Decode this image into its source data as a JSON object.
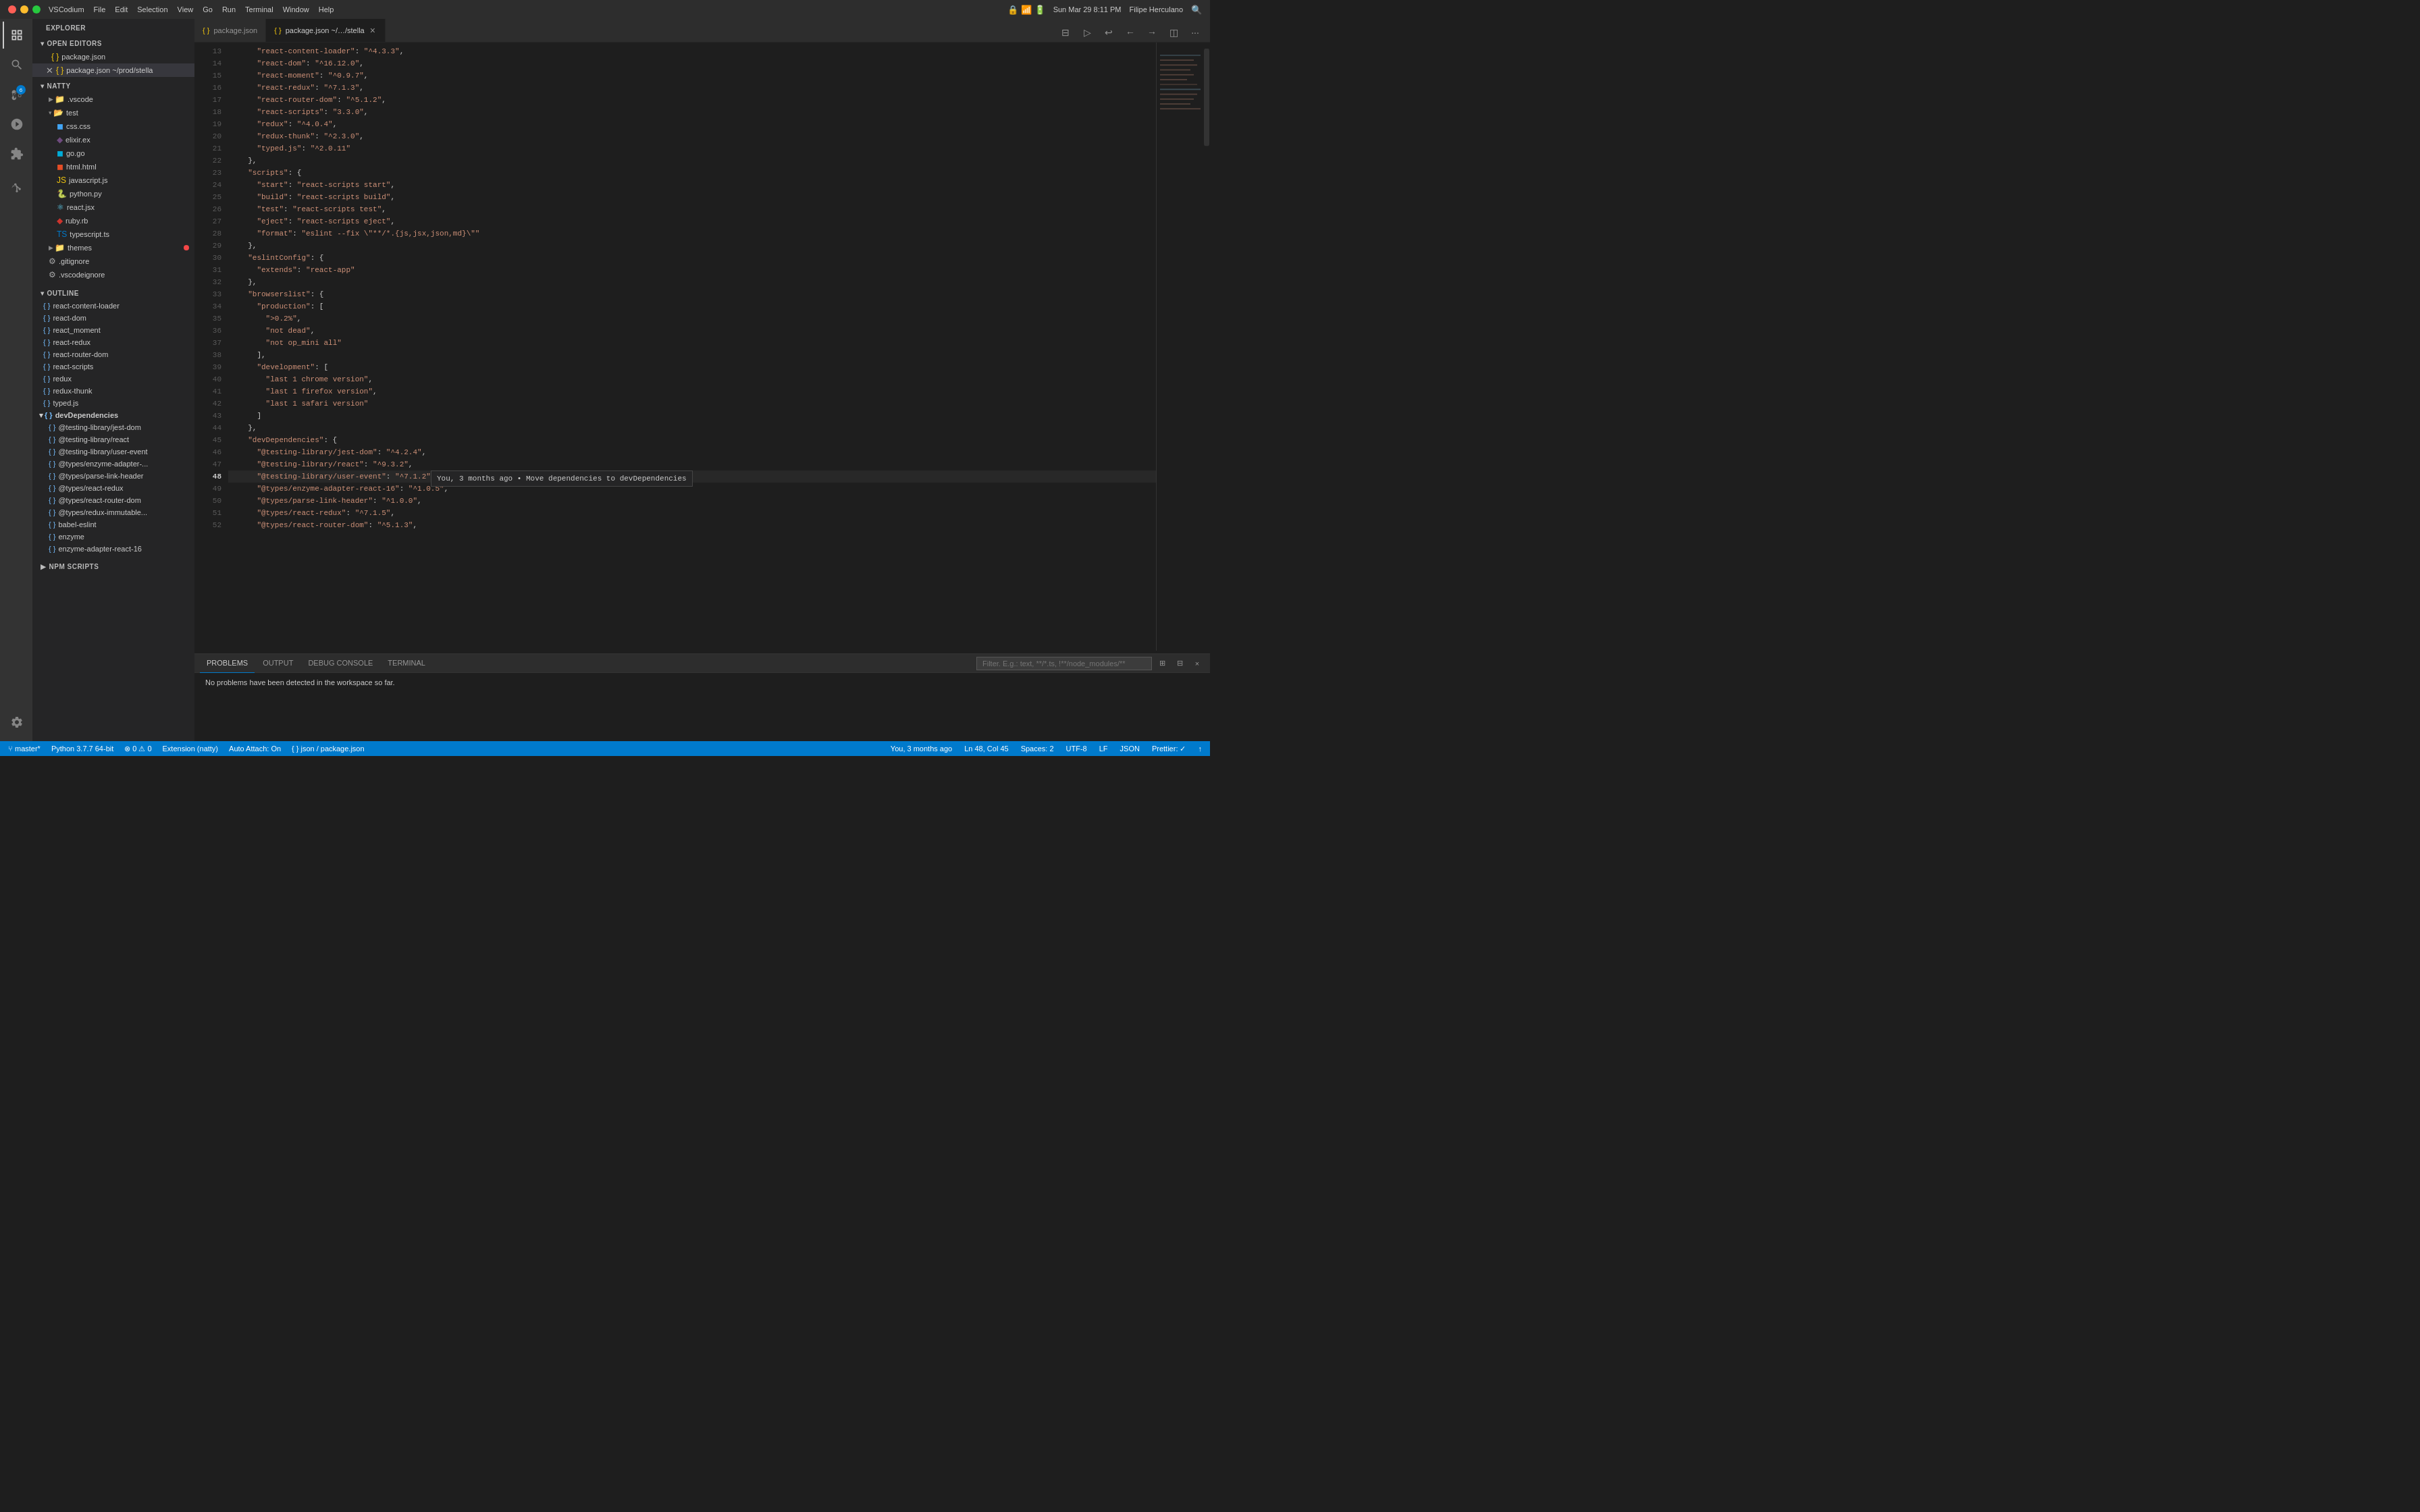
{
  "titlebar": {
    "app_name": "VSCodium",
    "apple_menu": "🍎",
    "menus": [
      "VSCodium",
      "File",
      "Edit",
      "Selection",
      "View",
      "Go",
      "Run",
      "Terminal",
      "Window",
      "Help"
    ],
    "time": "Sun Mar 29  8:11 PM",
    "user": "Filipe Herculano"
  },
  "sidebar": {
    "explorer_label": "EXPLORER",
    "open_editors_label": "OPEN EDITORS",
    "files": [
      {
        "name": "package.json",
        "type": "json",
        "modified": false
      },
      {
        "name": "package.json",
        "path": "~/prod/stella",
        "type": "json",
        "modified": true,
        "close": true
      }
    ],
    "natty_label": "NATTY",
    "natty_items": [
      {
        "name": ".vscode",
        "type": "folder",
        "indent": 0
      },
      {
        "name": "test",
        "type": "folder",
        "indent": 0
      },
      {
        "name": "css.css",
        "type": "css",
        "indent": 1
      },
      {
        "name": "elixir.ex",
        "type": "elixir",
        "indent": 1
      },
      {
        "name": "go.go",
        "type": "go",
        "indent": 1
      },
      {
        "name": "html.html",
        "type": "html",
        "indent": 1
      },
      {
        "name": "javascript.js",
        "type": "js",
        "indent": 1
      },
      {
        "name": "python.py",
        "type": "python",
        "indent": 1
      },
      {
        "name": "react.jsx",
        "type": "react",
        "indent": 1
      },
      {
        "name": "ruby.rb",
        "type": "ruby",
        "indent": 1
      },
      {
        "name": "typescript.ts",
        "type": "ts",
        "indent": 1
      },
      {
        "name": "themes",
        "type": "folder",
        "indent": 0,
        "dot": true
      },
      {
        "name": ".gitignore",
        "type": "file",
        "indent": 0
      },
      {
        "name": ".vscodeignore",
        "type": "file",
        "indent": 0
      }
    ],
    "outline_label": "OUTLINE",
    "outline_items": [
      "react-content-loader",
      "react-dom",
      "react_moment",
      "react-redux",
      "react-router-dom",
      "react-scripts",
      "redux",
      "redux-thunk",
      "typed.js",
      "devDependencies",
      "@testing-library/jest-dom",
      "@testing-library/react",
      "@testing-library/user-event",
      "@types/enzyme-adapter-...",
      "@types/parse-link-header",
      "@types/react-redux",
      "@types/react-router-dom",
      "@types/redux-immutable...",
      "babel-eslint",
      "enzyme",
      "enzyme-adapter-react-16"
    ],
    "npm_scripts_label": "NPM SCRIPTS"
  },
  "tabs": [
    {
      "label": "package.json",
      "path": "",
      "active": false,
      "icon": "json"
    },
    {
      "label": "package.json",
      "path": "~/…/stella",
      "active": true,
      "icon": "json",
      "close": true
    }
  ],
  "editor": {
    "lines": [
      {
        "num": 13,
        "content": "    \"react-content-loader\": \"^4.3.3\","
      },
      {
        "num": 14,
        "content": "    \"react-dom\": \"^16.12.0\","
      },
      {
        "num": 15,
        "content": "    \"react-moment\": \"^0.9.7\","
      },
      {
        "num": 16,
        "content": "    \"react-redux\": \"^7.1.3\","
      },
      {
        "num": 17,
        "content": "    \"react-router-dom\": \"^5.1.2\","
      },
      {
        "num": 18,
        "content": "    \"react-scripts\": \"3.3.0\","
      },
      {
        "num": 19,
        "content": "    \"redux\": \"^4.0.4\","
      },
      {
        "num": 20,
        "content": "    \"redux-thunk\": \"^2.3.0\","
      },
      {
        "num": 21,
        "content": "    \"typed.js\": \"^2.0.11\""
      },
      {
        "num": 22,
        "content": "  },"
      },
      {
        "num": 23,
        "content": "  \"scripts\": {"
      },
      {
        "num": 24,
        "content": "    \"start\": \"react-scripts start\","
      },
      {
        "num": 25,
        "content": "    \"build\": \"react-scripts build\","
      },
      {
        "num": 26,
        "content": "    \"test\": \"react-scripts test\","
      },
      {
        "num": 27,
        "content": "    \"eject\": \"react-scripts eject\","
      },
      {
        "num": 28,
        "content": "    \"format\": \"eslint --fix \\\"**/*.{js,jsx,json,md}\\\"\""
      },
      {
        "num": 29,
        "content": "  },"
      },
      {
        "num": 30,
        "content": "  \"eslintConfig\": {"
      },
      {
        "num": 31,
        "content": "    \"extends\": \"react-app\""
      },
      {
        "num": 32,
        "content": "  },"
      },
      {
        "num": 33,
        "content": "  \"browserslist\": {"
      },
      {
        "num": 34,
        "content": "    \"production\": ["
      },
      {
        "num": 35,
        "content": "      \">0.2%\","
      },
      {
        "num": 36,
        "content": "      \"not dead\","
      },
      {
        "num": 37,
        "content": "      \"not op_mini all\""
      },
      {
        "num": 38,
        "content": "    ],"
      },
      {
        "num": 39,
        "content": "    \"development\": ["
      },
      {
        "num": 40,
        "content": "      \"last 1 chrome version\","
      },
      {
        "num": 41,
        "content": "      \"last 1 firefox version\","
      },
      {
        "num": 42,
        "content": "      \"last 1 safari version\""
      },
      {
        "num": 43,
        "content": "    ]"
      },
      {
        "num": 44,
        "content": "  },"
      },
      {
        "num": 45,
        "content": "  \"devDependencies\": {"
      },
      {
        "num": 46,
        "content": "    \"@testing-library/jest-dom\": \"^4.2.4\","
      },
      {
        "num": 47,
        "content": "    \"@testing-library/react\": \"^9.3.2\","
      },
      {
        "num": 48,
        "content": "    \"@testing-library/user-event\": \"^7.1.2\",",
        "cursor": true
      },
      {
        "num": 49,
        "content": "    \"@types/enzyme-adapter-react-16\": \"^1.0.5\","
      },
      {
        "num": 50,
        "content": "    \"@types/parse-link-header\": \"^1.0.0\","
      },
      {
        "num": 51,
        "content": "    \"@types/react-redux\": \"^7.1.5\","
      },
      {
        "num": 52,
        "content": "    \"@types/react-router-dom\": \"^5.1.3\","
      }
    ],
    "tooltip": "You, 3 months ago • Move dependencies to devDependencies"
  },
  "panel": {
    "tabs": [
      "PROBLEMS",
      "OUTPUT",
      "DEBUG CONSOLE",
      "TERMINAL"
    ],
    "active_tab": "PROBLEMS",
    "filter_placeholder": "Filter. E.g.: text, **/*.ts, !**/node_modules/**",
    "content": "No problems have been detected in the workspace so far."
  },
  "status_bar": {
    "branch": "master*",
    "python": "Python 3.7.7 64-bit",
    "errors": "0",
    "warnings": "0",
    "extension": "Extension (natty)",
    "attach": "Auto Attach: On",
    "lang": "json",
    "file": "package.json",
    "git_status": "You, 3 months ago",
    "position": "Ln 48, Col 45",
    "spaces": "Spaces: 2",
    "encoding": "UTF-8",
    "eol": "LF",
    "filetype": "JSON",
    "prettier": "Prettier: ✓"
  }
}
